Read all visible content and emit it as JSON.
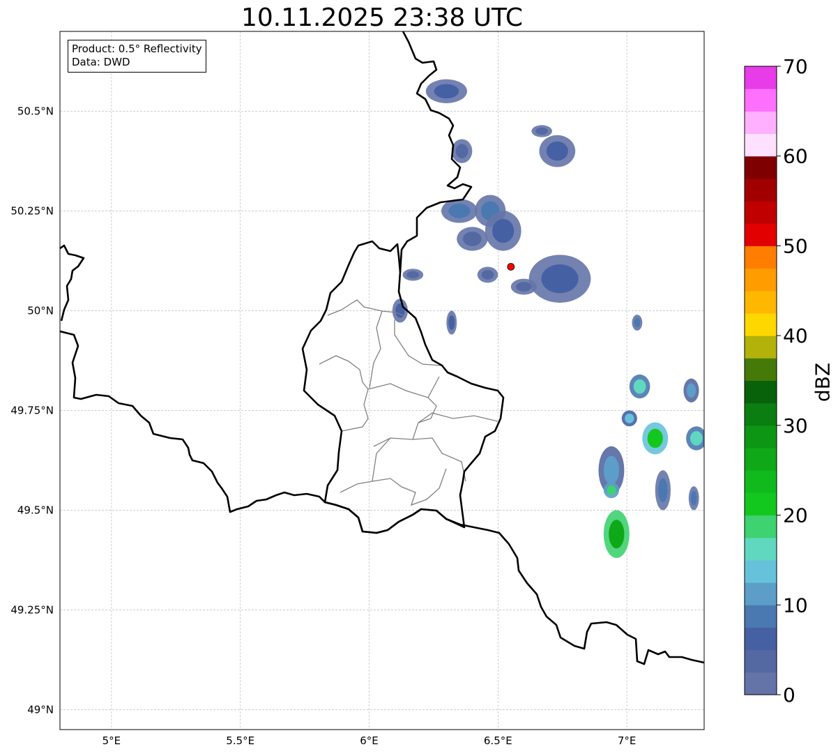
{
  "title": "10.11.2025 23:38 UTC",
  "info_box": {
    "product": "Product: 0.5° Reflectivity",
    "data_source": "Data: DWD"
  },
  "map": {
    "extent": {
      "lon_min": 4.8,
      "lon_max": 7.3,
      "lat_min": 48.95,
      "lat_max": 50.7
    },
    "lon_ticks": [
      {
        "value": 5.0,
        "label": "5°E"
      },
      {
        "value": 5.5,
        "label": "5.5°E"
      },
      {
        "value": 6.0,
        "label": "6°E"
      },
      {
        "value": 6.5,
        "label": "6.5°E"
      },
      {
        "value": 7.0,
        "label": "7°E"
      }
    ],
    "lat_ticks": [
      {
        "value": 50.5,
        "label": "50.5°N"
      },
      {
        "value": 50.25,
        "label": "50.25°N"
      },
      {
        "value": 50.0,
        "label": "50°N"
      },
      {
        "value": 49.75,
        "label": "49.75°N"
      },
      {
        "value": 49.5,
        "label": "49.5°N"
      },
      {
        "value": 49.25,
        "label": "49.25°N"
      },
      {
        "value": 49.0,
        "label": "49°N"
      }
    ],
    "radar_site": {
      "lon": 6.55,
      "lat": 50.11,
      "color": "#ff0000"
    },
    "border_color": "#000000",
    "district_color": "#808080",
    "grid": "on"
  },
  "colorbar": {
    "label": "dBZ",
    "min": 0,
    "max": 70,
    "ticks": [
      {
        "value": 0,
        "label": "0"
      },
      {
        "value": 10,
        "label": "10"
      },
      {
        "value": 20,
        "label": "20"
      },
      {
        "value": 30,
        "label": "30"
      },
      {
        "value": 40,
        "label": "40"
      },
      {
        "value": 50,
        "label": "50"
      },
      {
        "value": 60,
        "label": "60"
      },
      {
        "value": 70,
        "label": "70"
      }
    ],
    "colors": [
      "#6474a8",
      "#5468a2",
      "#4660a4",
      "#4a78b0",
      "#5c9ec8",
      "#66c2da",
      "#60d8c0",
      "#3ed270",
      "#12c81e",
      "#10ba1c",
      "#0ea818",
      "#0c9614",
      "#0a7e10",
      "#07620a",
      "#457a09",
      "#b2b20a",
      "#ffd700",
      "#ffb700",
      "#ff9c00",
      "#ff7e00",
      "#e20000",
      "#c00000",
      "#a00000",
      "#7f0000",
      "#ffe0ff",
      "#ffb0ff",
      "#ff70ff",
      "#e83ce8"
    ]
  },
  "echoes": [
    {
      "lon": 6.3,
      "lat": 50.55,
      "rx": 0.08,
      "ry": 0.03,
      "dbz": 5
    },
    {
      "lon": 6.67,
      "lat": 50.45,
      "rx": 0.04,
      "ry": 0.015,
      "dbz": 4
    },
    {
      "lon": 6.73,
      "lat": 50.4,
      "rx": 0.07,
      "ry": 0.04,
      "dbz": 7
    },
    {
      "lon": 6.36,
      "lat": 50.4,
      "rx": 0.04,
      "ry": 0.03,
      "dbz": 4
    },
    {
      "lon": 6.47,
      "lat": 50.25,
      "rx": 0.06,
      "ry": 0.04,
      "dbz": 9
    },
    {
      "lon": 6.52,
      "lat": 50.2,
      "rx": 0.07,
      "ry": 0.05,
      "dbz": 6
    },
    {
      "lon": 6.35,
      "lat": 50.25,
      "rx": 0.07,
      "ry": 0.03,
      "dbz": 8
    },
    {
      "lon": 6.4,
      "lat": 50.18,
      "rx": 0.06,
      "ry": 0.03,
      "dbz": 4
    },
    {
      "lon": 6.74,
      "lat": 50.08,
      "rx": 0.12,
      "ry": 0.06,
      "dbz": 5
    },
    {
      "lon": 6.6,
      "lat": 50.06,
      "rx": 0.05,
      "ry": 0.02,
      "dbz": 4
    },
    {
      "lon": 6.46,
      "lat": 50.09,
      "rx": 0.04,
      "ry": 0.02,
      "dbz": 4
    },
    {
      "lon": 6.12,
      "lat": 50.0,
      "rx": 0.03,
      "ry": 0.03,
      "dbz": 7
    },
    {
      "lon": 6.32,
      "lat": 49.97,
      "rx": 0.02,
      "ry": 0.03,
      "dbz": 6
    },
    {
      "lon": 6.17,
      "lat": 50.09,
      "rx": 0.04,
      "ry": 0.015,
      "dbz": 4
    },
    {
      "lon": 7.04,
      "lat": 49.97,
      "rx": 0.02,
      "ry": 0.02,
      "dbz": 8
    },
    {
      "lon": 7.05,
      "lat": 49.81,
      "rx": 0.04,
      "ry": 0.03,
      "dbz": 16
    },
    {
      "lon": 7.01,
      "lat": 49.73,
      "rx": 0.03,
      "ry": 0.02,
      "dbz": 14
    },
    {
      "lon": 7.11,
      "lat": 49.68,
      "rx": 0.05,
      "ry": 0.04,
      "dbz": 21
    },
    {
      "lon": 7.25,
      "lat": 49.8,
      "rx": 0.03,
      "ry": 0.03,
      "dbz": 12
    },
    {
      "lon": 7.27,
      "lat": 49.68,
      "rx": 0.04,
      "ry": 0.03,
      "dbz": 17
    },
    {
      "lon": 6.94,
      "lat": 49.6,
      "rx": 0.05,
      "ry": 0.06,
      "dbz": 12
    },
    {
      "lon": 7.14,
      "lat": 49.55,
      "rx": 0.03,
      "ry": 0.05,
      "dbz": 8
    },
    {
      "lon": 7.26,
      "lat": 49.53,
      "rx": 0.02,
      "ry": 0.03,
      "dbz": 8
    },
    {
      "lon": 6.96,
      "lat": 49.44,
      "rx": 0.05,
      "ry": 0.06,
      "dbz": 26
    },
    {
      "lon": 6.94,
      "lat": 49.55,
      "rx": 0.03,
      "ry": 0.02,
      "dbz": 19
    }
  ]
}
